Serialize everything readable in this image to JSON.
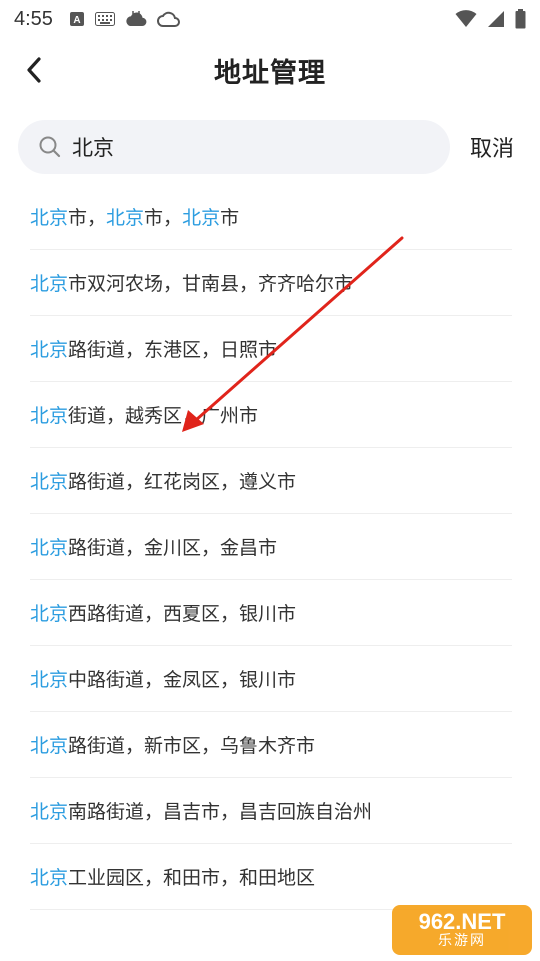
{
  "status_bar": {
    "time": "4:55",
    "left_icons": [
      "a-box-icon",
      "keyboard-icon",
      "weather-cloud-icon",
      "cloud-outline-icon"
    ],
    "right_icons": [
      "wifi-icon",
      "signal-icon",
      "battery-icon"
    ]
  },
  "header": {
    "title": "地址管理"
  },
  "search": {
    "value": "北京",
    "cancel_label": "取消"
  },
  "highlight_color": "#2c9de0",
  "results": [
    {
      "match": "北京",
      "rest_segments": [
        {
          "t": "市，"
        },
        {
          "h": "北京"
        },
        {
          "t": "市，"
        },
        {
          "h": "北京"
        },
        {
          "t": "市"
        }
      ]
    },
    {
      "match": "北京",
      "rest": "市双河农场，甘南县，齐齐哈尔市"
    },
    {
      "match": "北京",
      "rest": "路街道，东港区，日照市"
    },
    {
      "match": "北京",
      "rest": "街道，越秀区，广州市"
    },
    {
      "match": "北京",
      "rest": "路街道，红花岗区，遵义市"
    },
    {
      "match": "北京",
      "rest": "路街道，金川区，金昌市"
    },
    {
      "match": "北京",
      "rest": "西路街道，西夏区，银川市"
    },
    {
      "match": "北京",
      "rest": "中路街道，金凤区，银川市"
    },
    {
      "match": "北京",
      "rest": "路街道，新市区，乌鲁木齐市"
    },
    {
      "match": "北京",
      "rest": "南路街道，昌吉市，昌吉回族自治州"
    },
    {
      "match": "北京",
      "rest": "工业园区，和田市，和田地区"
    }
  ],
  "annotation": {
    "arrow_color": "#e0241b"
  },
  "watermark": {
    "top": "962.NET",
    "bottom": "乐游网"
  }
}
